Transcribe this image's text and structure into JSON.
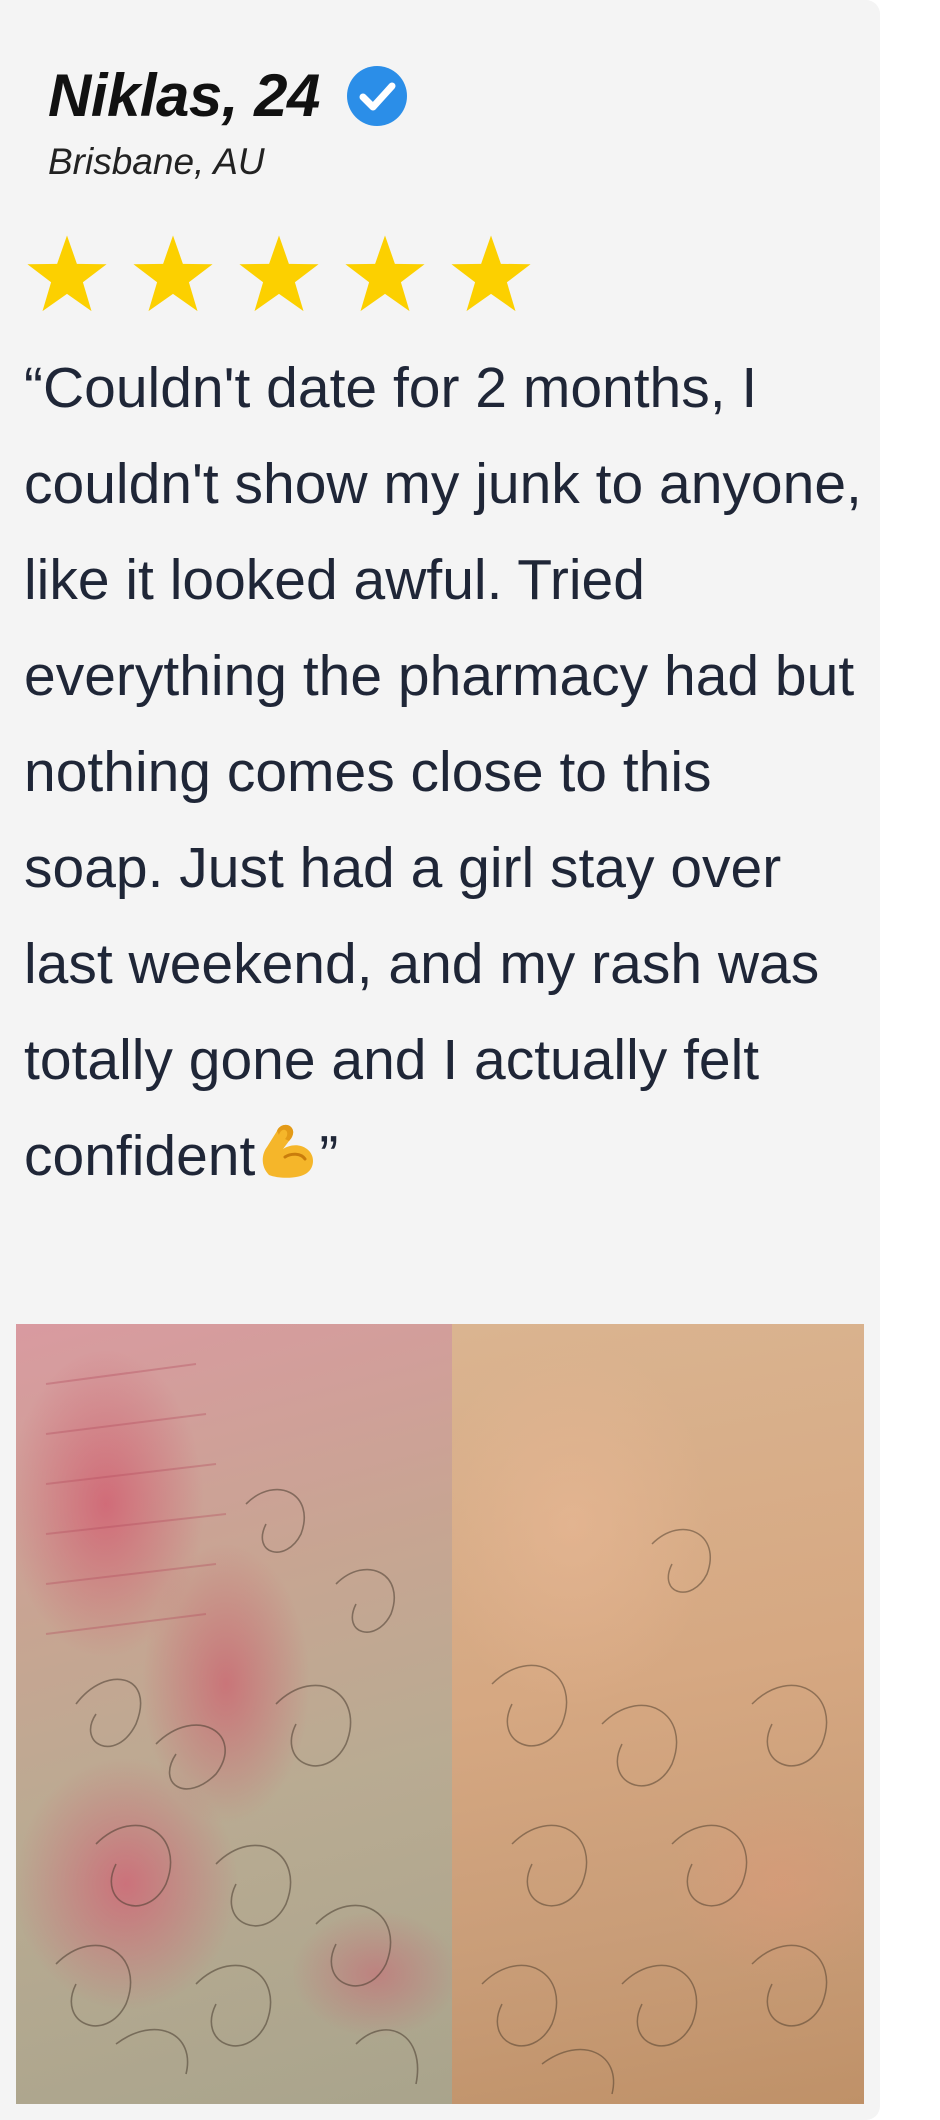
{
  "review": {
    "name": "Niklas, 24",
    "location": "Brisbane, AU",
    "rating": 5,
    "rating_max": 5,
    "quote_open": "“",
    "quote_text": "Couldn't date for 2 months, I couldn't show my junk to anyone, like it looked awful. Tried everything the pharmacy had but nothing comes close to this soap. Just had a girl stay over last weekend, and my rash was totally gone and I actually felt confident",
    "quote_emoji": "flexed-biceps-emoji",
    "quote_close": "”"
  },
  "icons": {
    "verified": "verified-badge-icon",
    "star": "star-icon"
  },
  "photos": {
    "before": "before-photo",
    "after": "after-photo"
  },
  "colors": {
    "card_background": "#f4f4f4",
    "verified_blue": "#2b8ee8",
    "star_gold": "#fcd000",
    "text_dark": "#1f2637"
  }
}
